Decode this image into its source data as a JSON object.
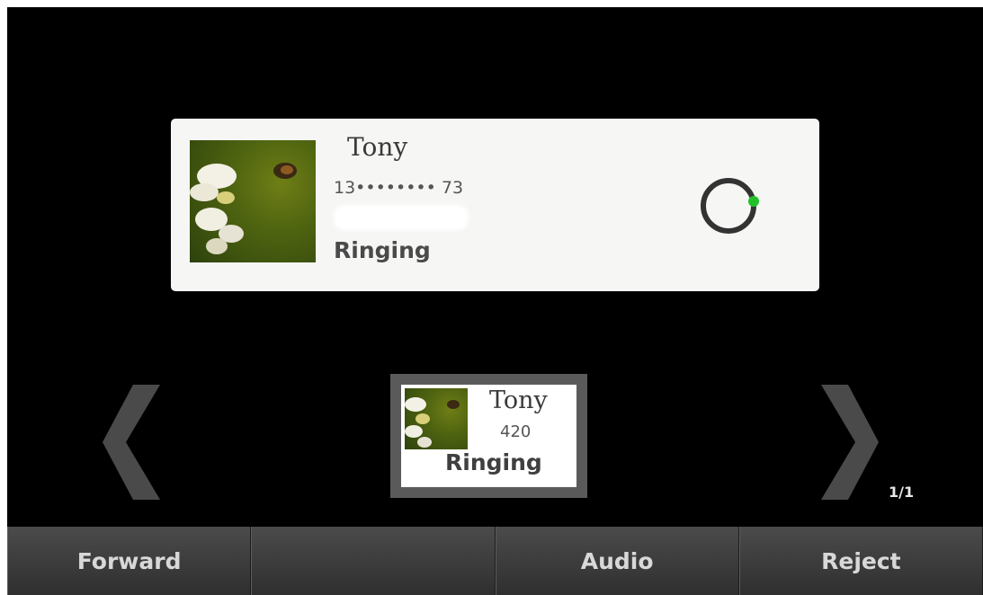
{
  "call": {
    "name": "Tony",
    "number": "13•••••••• 73",
    "status": "Ringing"
  },
  "thumbnail": {
    "name": "Tony",
    "number": "420",
    "status": "Ringing"
  },
  "pager": {
    "indicator": "1/1"
  },
  "softkeys": {
    "key1": "Forward",
    "key2": "",
    "key3": "Audio",
    "key4": "Reject"
  },
  "icons": {
    "left": "chevron-left-icon",
    "right": "chevron-right-icon",
    "spinner": "ringing-spinner-icon"
  },
  "colors": {
    "background": "#000000",
    "card": "#f6f6f4",
    "accent": "#22c12a"
  }
}
